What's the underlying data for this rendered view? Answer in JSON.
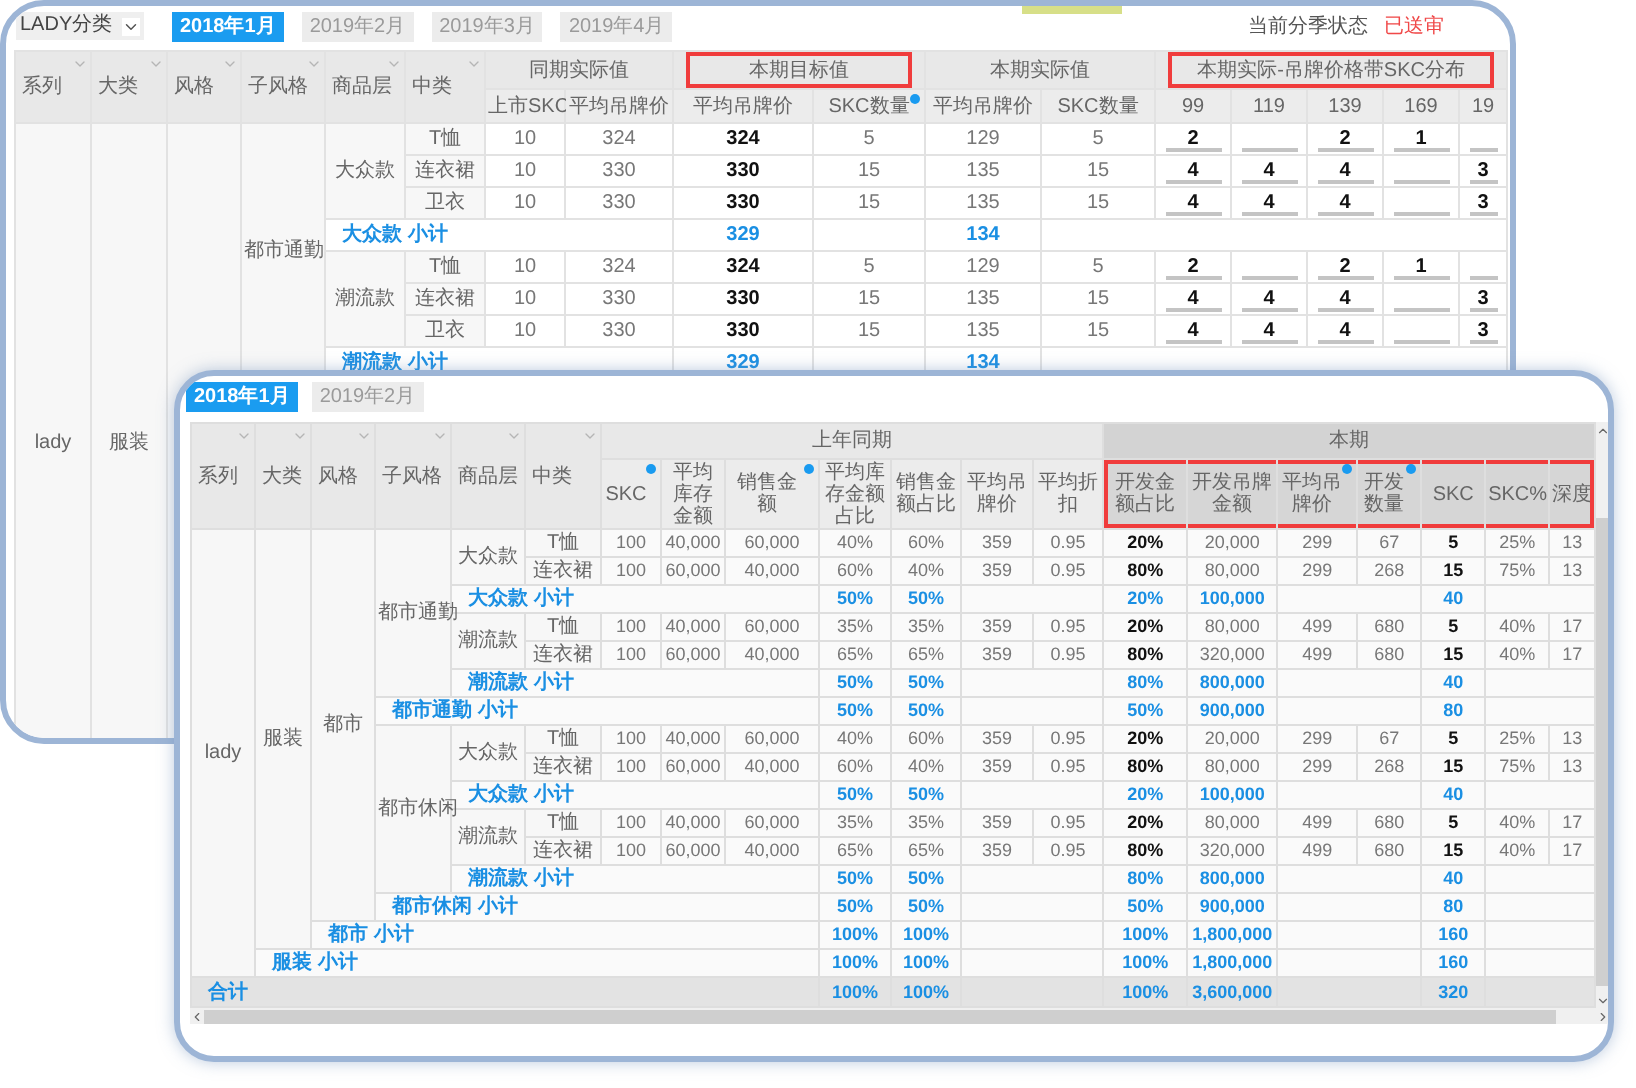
{
  "back_window": {
    "filter": {
      "value": "LADY分类"
    },
    "tabs": [
      {
        "label": "2018年1月",
        "selected": true
      },
      {
        "label": "2019年2月",
        "selected": false
      },
      {
        "label": "2019年3月",
        "selected": false
      },
      {
        "label": "2019年4月",
        "selected": false
      }
    ],
    "status": {
      "label": "当前分季状态",
      "value": "已送审"
    },
    "dimension_columns": [
      "系列",
      "大类",
      "风格",
      "子风格",
      "商品层",
      "中类"
    ],
    "column_groups": [
      {
        "label": "同期实际值",
        "highlighted": false,
        "columns": [
          {
            "label": "上市SKC",
            "dot": false,
            "emphasis": false
          },
          {
            "label": "平均吊牌价",
            "dot": false,
            "emphasis": false
          }
        ]
      },
      {
        "label": "本期目标值",
        "highlighted": true,
        "columns": [
          {
            "label": "平均吊牌价",
            "dot": false,
            "emphasis": true
          },
          {
            "label": "SKC数量",
            "dot": true,
            "emphasis": false
          }
        ]
      },
      {
        "label": "本期实际值",
        "highlighted": false,
        "columns": [
          {
            "label": "平均吊牌价",
            "dot": false,
            "emphasis": false
          },
          {
            "label": "SKC数量",
            "dot": false,
            "emphasis": false
          }
        ]
      },
      {
        "label": "本期实际-吊牌价格带SKC分布",
        "highlighted": true,
        "kind": "input",
        "columns": [
          {
            "label": "99",
            "dot": false
          },
          {
            "label": "119",
            "dot": false
          },
          {
            "label": "139",
            "dot": false
          },
          {
            "label": "169",
            "dot": false
          },
          {
            "label": "19",
            "dot": false
          }
        ]
      }
    ],
    "rows": [
      {
        "label": "lady",
        "children": [
          {
            "label": "服装",
            "children": [
              {
                "children": [
                  {
                    "label": "都市通勤",
                    "children": [
                      {
                        "label": "大众款",
                        "children": [
                          {
                            "label": "T恤",
                            "values": {
                              "column_1": "10",
                              "column_2": "324",
                              "column_3": "324",
                              "column_4": "5",
                              "column_5": "129",
                              "column_6": "5",
                              "column_7": "2",
                              "column_9": "2",
                              "column_10": "1"
                            }
                          },
                          {
                            "label": "连衣裙",
                            "values": {
                              "column_1": "10",
                              "column_2": "330",
                              "column_3": "330",
                              "column_4": "15",
                              "column_5": "135",
                              "column_6": "15",
                              "column_7": "4",
                              "column_8": "4",
                              "column_9": "4",
                              "column_11": "3"
                            }
                          },
                          {
                            "label": "卫衣",
                            "values": {
                              "column_1": "10",
                              "column_2": "330",
                              "column_3": "330",
                              "column_4": "15",
                              "column_5": "135",
                              "column_6": "15",
                              "column_7": "4",
                              "column_8": "4",
                              "column_9": "4",
                              "column_11": "3"
                            }
                          }
                        ],
                        "subtotal": {
                          "label": "大众款 小计",
                          "values": {
                            "column_3": "329",
                            "column_5": "134"
                          }
                        }
                      },
                      {
                        "label": "潮流款",
                        "children": [
                          {
                            "label": "T恤",
                            "values": {
                              "column_1": "10",
                              "column_2": "324",
                              "column_3": "324",
                              "column_4": "5",
                              "column_5": "129",
                              "column_6": "5",
                              "column_7": "2",
                              "column_9": "2",
                              "column_10": "1"
                            }
                          },
                          {
                            "label": "连衣裙",
                            "values": {
                              "column_1": "10",
                              "column_2": "330",
                              "column_3": "330",
                              "column_4": "15",
                              "column_5": "135",
                              "column_6": "15",
                              "column_7": "4",
                              "column_8": "4",
                              "column_9": "4",
                              "column_11": "3"
                            }
                          },
                          {
                            "label": "卫衣",
                            "values": {
                              "column_1": "10",
                              "column_2": "330",
                              "column_3": "330",
                              "column_4": "15",
                              "column_5": "135",
                              "column_6": "15",
                              "column_7": "4",
                              "column_8": "4",
                              "column_9": "4",
                              "column_11": "3"
                            }
                          }
                        ],
                        "subtotal": {
                          "label": "潮流款 小计",
                          "values": {
                            "column_3": "329",
                            "column_5": "134"
                          }
                        }
                      }
                    ]
                  }
                ]
              }
            ]
          }
        ]
      }
    ]
  },
  "front_window": {
    "tabs": [
      {
        "label": "2018年1月",
        "selected": true
      },
      {
        "label": "2019年2月",
        "selected": false
      }
    ],
    "dimension_columns": [
      "系列",
      "大类",
      "风格",
      "子风格",
      "商品层",
      "中类"
    ],
    "column_groups": [
      {
        "label": "上年同期",
        "shaded": false,
        "columns": [
          {
            "label": "SKC",
            "dot": true,
            "emphasis": false,
            "highlighted": false
          },
          {
            "label": "平均库存金额",
            "dot": false,
            "emphasis": false,
            "highlighted": false
          },
          {
            "label": "销售金额",
            "dot": true,
            "emphasis": false,
            "highlighted": false
          },
          {
            "label": "平均库存金额占比",
            "dot": false,
            "emphasis": false,
            "highlighted": false
          },
          {
            "label": "销售金额占比",
            "dot": false,
            "emphasis": false,
            "highlighted": false
          },
          {
            "label": "平均吊牌价",
            "dot": false,
            "emphasis": false,
            "highlighted": false
          },
          {
            "label": "平均折扣",
            "dot": false,
            "emphasis": false,
            "highlighted": false
          }
        ]
      },
      {
        "label": "本期",
        "shaded": true,
        "columns": [
          {
            "label": "开发金额占比",
            "dot": false,
            "emphasis": true,
            "highlighted": true
          },
          {
            "label": "开发吊牌金额",
            "dot": false,
            "emphasis": false,
            "highlighted": true
          },
          {
            "label": "平均吊牌价",
            "dot": true,
            "emphasis": false,
            "highlighted": true
          },
          {
            "label": "开发数量",
            "dot": true,
            "emphasis": false,
            "highlighted": true
          },
          {
            "label": "SKC",
            "dot": false,
            "emphasis": true,
            "highlighted": true
          },
          {
            "label": "SKC%",
            "dot": false,
            "emphasis": false,
            "highlighted": true
          },
          {
            "label": "深度",
            "dot": false,
            "emphasis": false,
            "highlighted": true
          }
        ]
      }
    ],
    "rows": [
      {
        "label": "lady",
        "children": [
          {
            "label": "服装",
            "children": [
              {
                "label": "都市",
                "children": [
                  {
                    "label": "都市通勤",
                    "children": [
                      {
                        "label": "大众款",
                        "children": [
                          {
                            "label": "T恤",
                            "values": {
                              "column_1": "100",
                              "column_2": "40,000",
                              "column_3": "60,000",
                              "column_4": "40%",
                              "column_5": "60%",
                              "column_6": "359",
                              "column_7": "0.95",
                              "column_8": "20%",
                              "column_9": "20,000",
                              "column_10": "299",
                              "column_11": "67",
                              "column_12": "5",
                              "column_13": "25%",
                              "column_14": "13"
                            }
                          },
                          {
                            "label": "连衣裙",
                            "values": {
                              "column_1": "100",
                              "column_2": "60,000",
                              "column_3": "40,000",
                              "column_4": "60%",
                              "column_5": "40%",
                              "column_6": "359",
                              "column_7": "0.95",
                              "column_8": "80%",
                              "column_9": "80,000",
                              "column_10": "299",
                              "column_11": "268",
                              "column_12": "15",
                              "column_13": "75%",
                              "column_14": "13"
                            }
                          }
                        ],
                        "subtotal": {
                          "label": "大众款 小计",
                          "values": {
                            "column_4": "50%",
                            "column_5": "50%",
                            "column_8": "20%",
                            "column_9": "100,000",
                            "column_12": "40"
                          }
                        }
                      },
                      {
                        "label": "潮流款",
                        "children": [
                          {
                            "label": "T恤",
                            "values": {
                              "column_1": "100",
                              "column_2": "40,000",
                              "column_3": "60,000",
                              "column_4": "35%",
                              "column_5": "35%",
                              "column_6": "359",
                              "column_7": "0.95",
                              "column_8": "20%",
                              "column_9": "80,000",
                              "column_10": "499",
                              "column_11": "680",
                              "column_12": "5",
                              "column_13": "40%",
                              "column_14": "17"
                            }
                          },
                          {
                            "label": "连衣裙",
                            "values": {
                              "column_1": "100",
                              "column_2": "60,000",
                              "column_3": "40,000",
                              "column_4": "65%",
                              "column_5": "65%",
                              "column_6": "359",
                              "column_7": "0.95",
                              "column_8": "80%",
                              "column_9": "320,000",
                              "column_10": "499",
                              "column_11": "680",
                              "column_12": "15",
                              "column_13": "40%",
                              "column_14": "17"
                            }
                          }
                        ],
                        "subtotal": {
                          "label": "潮流款 小计",
                          "values": {
                            "column_4": "50%",
                            "column_5": "50%",
                            "column_8": "80%",
                            "column_9": "800,000",
                            "column_12": "40"
                          }
                        }
                      }
                    ],
                    "subtotal": {
                      "label": "都市通勤 小计",
                      "values": {
                        "column_4": "50%",
                        "column_5": "50%",
                        "column_8": "50%",
                        "column_9": "900,000",
                        "column_12": "80"
                      }
                    }
                  },
                  {
                    "label": "都市休闲",
                    "children": [
                      {
                        "label": "大众款",
                        "children": [
                          {
                            "label": "T恤",
                            "values": {
                              "column_1": "100",
                              "column_2": "40,000",
                              "column_3": "60,000",
                              "column_4": "40%",
                              "column_5": "60%",
                              "column_6": "359",
                              "column_7": "0.95",
                              "column_8": "20%",
                              "column_9": "20,000",
                              "column_10": "299",
                              "column_11": "67",
                              "column_12": "5",
                              "column_13": "25%",
                              "column_14": "13"
                            }
                          },
                          {
                            "label": "连衣裙",
                            "values": {
                              "column_1": "100",
                              "column_2": "60,000",
                              "column_3": "40,000",
                              "column_4": "60%",
                              "column_5": "40%",
                              "column_6": "359",
                              "column_7": "0.95",
                              "column_8": "80%",
                              "column_9": "80,000",
                              "column_10": "299",
                              "column_11": "268",
                              "column_12": "15",
                              "column_13": "75%",
                              "column_14": "13"
                            }
                          }
                        ],
                        "subtotal": {
                          "label": "大众款 小计",
                          "values": {
                            "column_4": "50%",
                            "column_5": "50%",
                            "column_8": "20%",
                            "column_9": "100,000",
                            "column_12": "40"
                          }
                        }
                      },
                      {
                        "label": "潮流款",
                        "children": [
                          {
                            "label": "T恤",
                            "values": {
                              "column_1": "100",
                              "column_2": "40,000",
                              "column_3": "60,000",
                              "column_4": "35%",
                              "column_5": "35%",
                              "column_6": "359",
                              "column_7": "0.95",
                              "column_8": "20%",
                              "column_9": "80,000",
                              "column_10": "499",
                              "column_11": "680",
                              "column_12": "5",
                              "column_13": "40%",
                              "column_14": "17"
                            }
                          },
                          {
                            "label": "连衣裙",
                            "values": {
                              "column_1": "100",
                              "column_2": "60,000",
                              "column_3": "40,000",
                              "column_4": "65%",
                              "column_5": "65%",
                              "column_6": "359",
                              "column_7": "0.95",
                              "column_8": "80%",
                              "column_9": "320,000",
                              "column_10": "499",
                              "column_11": "680",
                              "column_12": "15",
                              "column_13": "40%",
                              "column_14": "17"
                            }
                          }
                        ],
                        "subtotal": {
                          "label": "潮流款 小计",
                          "values": {
                            "column_4": "50%",
                            "column_5": "50%",
                            "column_8": "80%",
                            "column_9": "800,000",
                            "column_12": "40"
                          }
                        }
                      }
                    ],
                    "subtotal": {
                      "label": "都市休闲 小计",
                      "values": {
                        "column_4": "50%",
                        "column_5": "50%",
                        "column_8": "50%",
                        "column_9": "900,000",
                        "column_12": "80"
                      }
                    }
                  }
                ],
                "subtotal": {
                  "label": "都市 小计",
                  "values": {
                    "column_4": "100%",
                    "column_5": "100%",
                    "column_8": "100%",
                    "column_9": "1,800,000",
                    "column_12": "160"
                  }
                }
              }
            ],
            "subtotal": {
              "label": "服装 小计",
              "values": {
                "column_4": "100%",
                "column_5": "100%",
                "column_8": "100%",
                "column_9": "1,800,000",
                "column_12": "160"
              }
            }
          }
        ]
      }
    ],
    "total": {
      "label": "合计",
      "values": {
        "column_4": "100%",
        "column_5": "100%",
        "column_8": "100%",
        "column_9": "3,600,000",
        "column_12": "320"
      }
    }
  }
}
